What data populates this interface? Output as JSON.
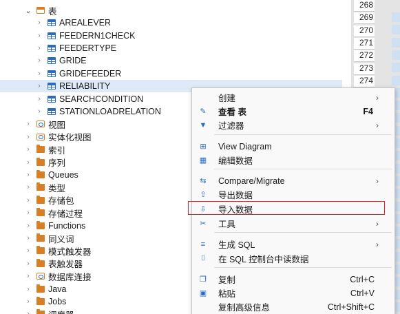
{
  "tree": {
    "root_label": "表",
    "tables": [
      "AREALEVER",
      "FEEDERN1CHECK",
      "FEEDERTYPE",
      "GRIDE",
      "GRIDEFEEDER",
      "RELIABILITY",
      "SEARCHCONDITION",
      "STATIONLOADRELATION"
    ],
    "selected_table": "RELIABILITY",
    "folders": [
      {
        "label": "视图",
        "icon": "view-icon"
      },
      {
        "label": "实体化视图",
        "icon": "view-icon"
      },
      {
        "label": "索引",
        "icon": "folder-icon"
      },
      {
        "label": "序列",
        "icon": "folder-icon"
      },
      {
        "label": "Queues",
        "icon": "folder-icon"
      },
      {
        "label": "类型",
        "icon": "folder-icon"
      },
      {
        "label": "存储包",
        "icon": "folder-icon"
      },
      {
        "label": "存储过程",
        "icon": "folder-icon"
      },
      {
        "label": "Functions",
        "icon": "folder-icon"
      },
      {
        "label": "同义词",
        "icon": "folder-icon"
      },
      {
        "label": "模式触发器",
        "icon": "folder-icon"
      },
      {
        "label": "表触发器",
        "icon": "folder-icon"
      },
      {
        "label": "数据库连接",
        "icon": "view-icon"
      },
      {
        "label": "Java",
        "icon": "folder-icon"
      },
      {
        "label": "Jobs",
        "icon": "folder-icon"
      },
      {
        "label": "调度器",
        "icon": "folder-icon"
      }
    ]
  },
  "gutter": {
    "line_numbers": [
      "268",
      "269",
      "270",
      "271",
      "272",
      "273",
      "274"
    ]
  },
  "context_menu": {
    "items": [
      {
        "label": "创建",
        "shortcut": "",
        "submenu": true,
        "icon": ""
      },
      {
        "label": "查看 表",
        "shortcut": "F4",
        "submenu": false,
        "icon": "pencil-icon",
        "bold": true
      },
      {
        "label": "过滤器",
        "shortcut": "",
        "submenu": true,
        "icon": "filter-icon"
      },
      {
        "label": "View Diagram",
        "shortcut": "",
        "submenu": false,
        "icon": "diagram-icon"
      },
      {
        "label": "编辑数据",
        "shortcut": "",
        "submenu": false,
        "icon": "edit-data-icon"
      },
      {
        "label": "Compare/Migrate",
        "shortcut": "",
        "submenu": true,
        "icon": "compare-icon"
      },
      {
        "label": "导出数据",
        "shortcut": "",
        "submenu": false,
        "icon": "export-icon"
      },
      {
        "label": "导入数据",
        "shortcut": "",
        "submenu": false,
        "icon": "import-icon"
      },
      {
        "label": "工具",
        "shortcut": "",
        "submenu": true,
        "icon": "tools-icon"
      },
      {
        "label": "生成 SQL",
        "shortcut": "",
        "submenu": true,
        "icon": "sql-icon"
      },
      {
        "label": "在 SQL 控制台中读数据",
        "shortcut": "",
        "submenu": false,
        "icon": "console-icon"
      },
      {
        "label": "复制",
        "shortcut": "Ctrl+C",
        "submenu": false,
        "icon": "copy-icon"
      },
      {
        "label": "粘贴",
        "shortcut": "Ctrl+V",
        "submenu": false,
        "icon": "paste-icon"
      },
      {
        "label": "复制高级信息",
        "shortcut": "Ctrl+Shift+C",
        "submenu": false,
        "icon": ""
      }
    ],
    "highlighted_item": "导入数据",
    "highlight_color": "#e0262a"
  },
  "colors": {
    "accent": "#2a6cc2",
    "folder": "#d87e24",
    "selection": "#dfeaf8"
  }
}
